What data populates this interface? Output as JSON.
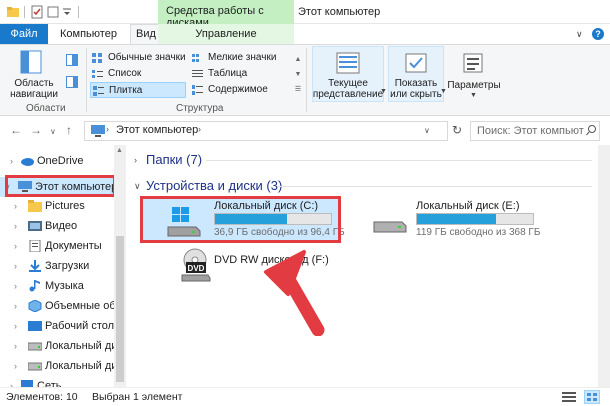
{
  "window": {
    "title": "Этот компьютер",
    "context_group": "Средства работы с дисками"
  },
  "tabs": {
    "file": "Файл",
    "computer": "Компьютер",
    "view": "Вид",
    "manage": "Управление"
  },
  "ribbon": {
    "areas": {
      "nav_pane_label": "Область навигации",
      "nav_pane_line1": "Область",
      "nav_pane_line2": "навигации",
      "group_label": "Области"
    },
    "layout": {
      "items": [
        "Обычные значки",
        "Мелкие значки",
        "Список",
        "Таблица",
        "Плитка",
        "Содержимое"
      ],
      "selected": "Плитка",
      "group_label": "Структура"
    },
    "current_view": {
      "line1": "Текущее",
      "line2": "представление"
    },
    "show_hide": {
      "line1": "Показать",
      "line2": "или скрыть"
    },
    "options": {
      "label": "Параметры"
    }
  },
  "address": {
    "path_text": "Этот компьютер",
    "search_placeholder": "Поиск: Этот компьют"
  },
  "nav": {
    "items": [
      {
        "label": "OneDrive",
        "icon": "cloud-icon"
      },
      {
        "label": "Этот компьютер",
        "icon": "computer-icon"
      },
      {
        "label": "Pictures",
        "icon": "folder-icon"
      },
      {
        "label": "Видео",
        "icon": "video-icon"
      },
      {
        "label": "Документы",
        "icon": "documents-icon"
      },
      {
        "label": "Загрузки",
        "icon": "downloads-icon"
      },
      {
        "label": "Музыка",
        "icon": "music-icon"
      },
      {
        "label": "Объемные объ",
        "icon": "3d-objects-icon"
      },
      {
        "label": "Рабочий стол",
        "icon": "desktop-icon"
      },
      {
        "label": "Локальный дис",
        "icon": "drive-icon"
      },
      {
        "label": "Локальный дис",
        "icon": "drive-icon"
      },
      {
        "label": "Сеть",
        "icon": "network-icon"
      }
    ]
  },
  "sections": {
    "folders": "Папки (7)",
    "devices": "Устройства и диски (3)"
  },
  "drives": [
    {
      "name": "Локальный диск (C:)",
      "free": "36,9 ГБ свободно из 96,4 ГБ",
      "used_fraction": 0.617
    },
    {
      "name": "Локальный диск (E:)",
      "free": "119 ГБ свободно из 368 ГБ",
      "used_fraction": 0.677
    },
    {
      "name": "DVD RW дисковод (F:)",
      "dvd_badge": "DVD"
    }
  ],
  "status": {
    "count": "Элементов: 10",
    "selected": "Выбран 1 элемент"
  },
  "colors": {
    "accent": "#1979ca",
    "highlight": "#e23b41",
    "drive_bar": "#26a0da",
    "context_tab": "#c3efc3"
  }
}
